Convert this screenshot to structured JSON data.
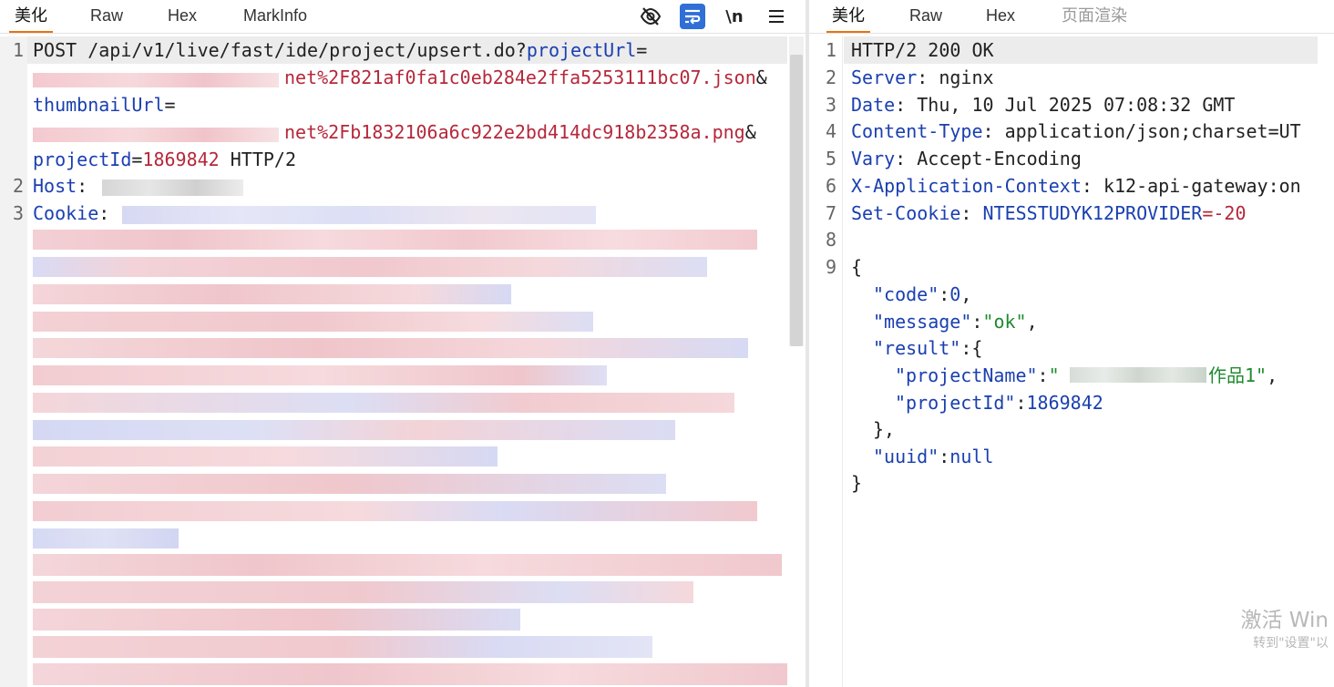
{
  "request_panel": {
    "tabs": [
      "美化",
      "Raw",
      "Hex",
      "MarkInfo"
    ],
    "active_tab": "美化",
    "icons": [
      "eye-slash-icon",
      "word-wrap-icon",
      "newline-icon",
      "menu-icon"
    ],
    "lines": {
      "l1_method_path": "POST /api/v1/live/fast/ide/project/upsert.do?",
      "l1_param1_key": "projectUrl",
      "l1_eq1": "=",
      "l1_param1_val": "net%2F821af0fa1c0eb284e2ffa5253111bc07.json",
      "l1_amp1": "&",
      "l1_param2_key": "thumbnailUrl",
      "l1_eq2": "=",
      "l1_param2_val": "net%2Fb1832106a6c922e2bd414dc918b2358a.png",
      "l1_amp2": "&",
      "l1_param3_key": "projectId",
      "l1_eq3": "=",
      "l1_param3_val": "1869842",
      "l1_protocol": " HTTP/2",
      "l2_key": "Host",
      "l2_sep": ": ",
      "l3_key": "Cookie",
      "l3_sep": ": "
    },
    "line_numbers": [
      "1",
      "2",
      "3"
    ]
  },
  "response_panel": {
    "tabs": [
      "美化",
      "Raw",
      "Hex",
      "页面渲染"
    ],
    "active_tab": "美化",
    "line_numbers": [
      "1",
      "2",
      "3",
      "4",
      "5",
      "6",
      "7",
      "8",
      "9"
    ],
    "status_line": "HTTP/2 200 OK",
    "headers": [
      {
        "key": "Server",
        "value": "nginx"
      },
      {
        "key": "Date",
        "value": "Thu, 10 Jul 2025 07:08:32 GMT"
      },
      {
        "key": "Content-Type",
        "value": "application/json;charset=UT"
      },
      {
        "key": "Vary",
        "value": "Accept-Encoding"
      },
      {
        "key": "X-Application-Context",
        "value": "k12-api-gateway:on"
      },
      {
        "key": "Set-Cookie",
        "value_key": "NTESSTUDYK12PROVIDER",
        "value_rest": "=-20"
      }
    ],
    "json": {
      "open_brace": "{",
      "code_key": "\"code\"",
      "code_val": "0",
      "message_key": "\"message\"",
      "message_val": "\"ok\"",
      "result_key": "\"result\"",
      "projectName_key": "\"projectName\"",
      "projectName_val_visible": "作品1\"",
      "projectId_key": "\"projectId\"",
      "projectId_val": "1869842",
      "close_result": "},",
      "uuid_key": "\"uuid\"",
      "uuid_val": "null",
      "close_brace": "}"
    }
  },
  "watermark": {
    "line1": "激活 Win",
    "line2": "转到\"设置\"以"
  },
  "colors": {
    "accent": "#e8740c",
    "key_blue": "#1a3fb0",
    "url_red": "#b5283a",
    "string_green": "#1f8a2e",
    "active_icon_bg": "#2f6fd6"
  }
}
